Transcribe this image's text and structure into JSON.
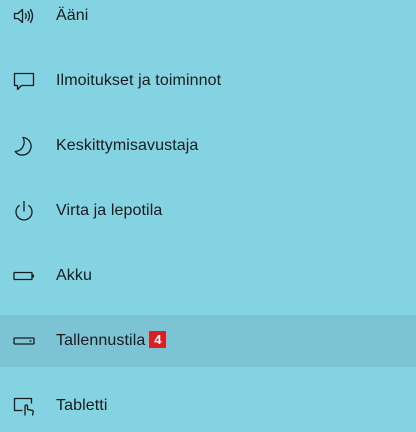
{
  "theme": {
    "background": "#84d3e3",
    "selected_background": "#7cc3d4",
    "text_color": "#1b1b1b",
    "badge_color": "#d72020"
  },
  "nav": {
    "items": [
      {
        "label": "Ääni",
        "icon": "speaker-icon"
      },
      {
        "label": "Ilmoitukset ja toiminnot",
        "icon": "notification-icon"
      },
      {
        "label": "Keskittymisavustaja",
        "icon": "moon-icon"
      },
      {
        "label": "Virta ja lepotila",
        "icon": "power-icon"
      },
      {
        "label": "Akku",
        "icon": "battery-icon"
      },
      {
        "label": "Tallennustila",
        "icon": "storage-drive-icon",
        "selected": true,
        "badge": "4"
      },
      {
        "label": "Tabletti",
        "icon": "tablet-icon"
      }
    ]
  }
}
